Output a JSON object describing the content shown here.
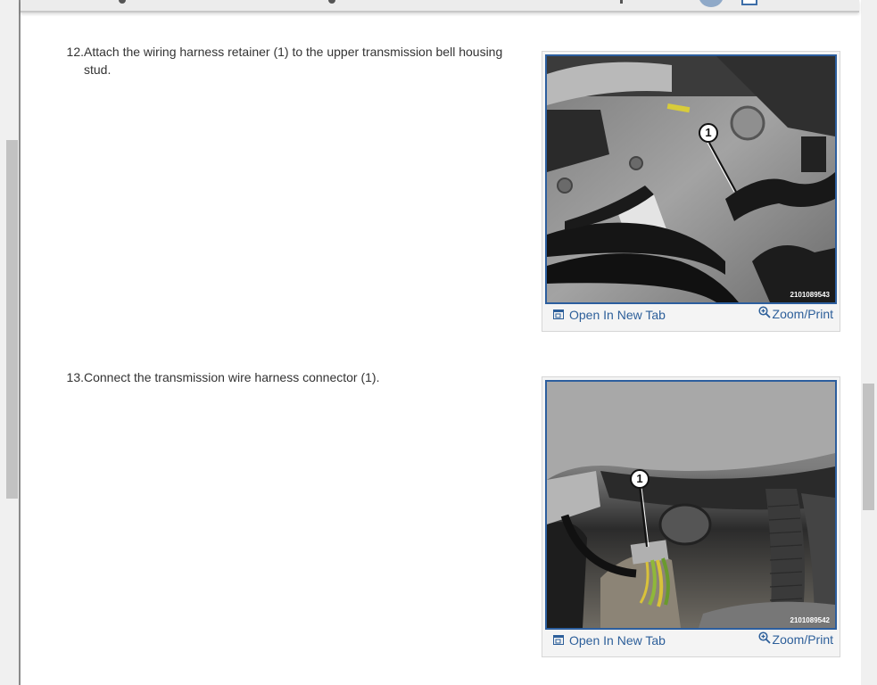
{
  "steps": [
    {
      "number": "12.",
      "text": "Attach the wiring harness retainer (1) to the upper transmission bell housing stud.",
      "figure": {
        "callout": "1",
        "code": "2101089543",
        "open_label": "Open In New Tab",
        "zoom_label": "Zoom/Print"
      }
    },
    {
      "number": "13.",
      "text": "Connect the transmission wire harness connector (1).",
      "figure": {
        "callout": "1",
        "code": "2101089542",
        "open_label": "Open In New Tab",
        "zoom_label": "Zoom/Print"
      }
    }
  ],
  "colors": {
    "link": "#2d5f9a",
    "figure_border": "#2c5e9e",
    "text": "#333333"
  },
  "icons": [
    "open-new-tab-icon",
    "zoom-icon"
  ]
}
